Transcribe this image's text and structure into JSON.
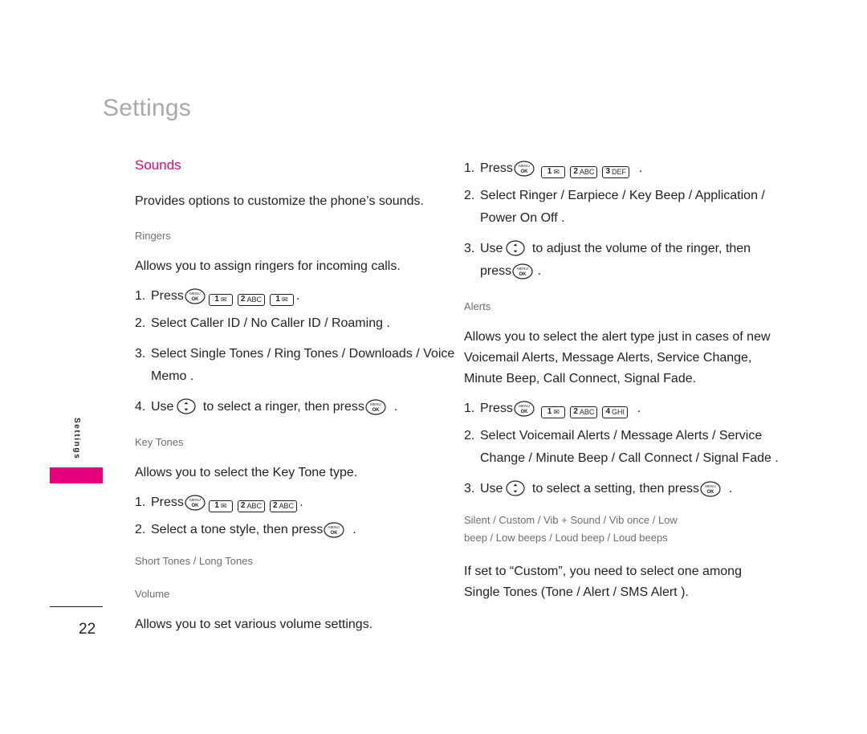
{
  "page": {
    "title": "Settings",
    "side_tab_label": "Settings",
    "page_number": "22"
  },
  "left": {
    "section_title": "Sounds",
    "intro": "Provides options to customize the phone’s sounds.",
    "ringers": {
      "heading": "Ringers",
      "body": "Allows you to assign ringers for incoming calls.",
      "step1_num": "1.",
      "step1_label": "Press",
      "step1_keys": [
        "MENU/OK",
        "1",
        "2 ABC",
        "1"
      ],
      "step1_tail": ".",
      "step2_num": "2.",
      "step2_text": "Select Caller ID / No Caller ID / Roaming .",
      "step3_num": "3.",
      "step3_text": "Select Single Tones / Ring Tones / Downloads / Voice Memo .",
      "step4_num": "4.",
      "step4_text_a": "Use",
      "step4_text_b": "to select a ringer, then press",
      "step4_tail": "."
    },
    "key_tones": {
      "heading": "Key Tones",
      "body": "Allows you to select the Key Tone type.",
      "step1_num": "1.",
      "step1_label": "Press",
      "step1_keys": [
        "MENU/OK",
        "1",
        "2 ABC",
        "2 ABC"
      ],
      "step1_tail": ".",
      "step2_num": "2.",
      "step2_text_a": "Select a tone style, then press",
      "step2_tail": ".",
      "note": "Short Tones / Long Tones"
    },
    "volume": {
      "heading": "Volume",
      "body": "Allows you to set various volume settings."
    }
  },
  "right": {
    "volume_steps": {
      "step1_num": "1.",
      "step1_label": "Press",
      "step1_keys": [
        "MENU/OK",
        "1",
        "2 ABC",
        "3 DEF"
      ],
      "step1_tail": ".",
      "step2_num": "2.",
      "step2_text": "Select Ringer / Earpiece / Key Beep / Application / Power On Off .",
      "step3_num": "3.",
      "step3_text_a": "Use",
      "step3_text_b": "to adjust the volume of the ringer, then press",
      "step3_tail": "."
    },
    "alerts": {
      "heading": "Alerts",
      "body": "Allows you to select the alert type just in cases of new Voicemail Alerts, Message Alerts, Service Change, Minute Beep, Call Connect, Signal Fade.",
      "step1_num": "1.",
      "step1_label": "Press",
      "step1_keys": [
        "MENU/OK",
        "1",
        "2 ABC",
        "4 GHI"
      ],
      "step1_tail": ".",
      "step2_num": "2.",
      "step2_text": "Select Voicemail Alerts / Message Alerts / Service Change / Minute Beep / Call Connect / Signal Fade .",
      "step3_num": "3.",
      "step3_text_a": "Use",
      "step3_text_b": "to select a setting, then press",
      "step3_tail": ".",
      "options_line1": "Silent / Custom / Vib + Sound / Vib once / Low",
      "options_line2": "beep / Low beeps / Loud beep / Loud beeps",
      "tip_line1_a": "If set to",
      "tip_line1_b": "“Custom”, you need to select one among",
      "tip_line2_a": "Single Tones (",
      "tip_line2_b": "Tone / Alert / SMS Alert )."
    }
  },
  "icons": {
    "menu_ok": "menu-ok-key-icon",
    "nav_ring": "navigation-ring-key-icon",
    "envelope": "envelope-icon"
  },
  "colors": {
    "accent": "#e6007e",
    "title_gray": "#a7a9ac",
    "sub_gray": "#6d6e71",
    "text": "#231f20"
  }
}
